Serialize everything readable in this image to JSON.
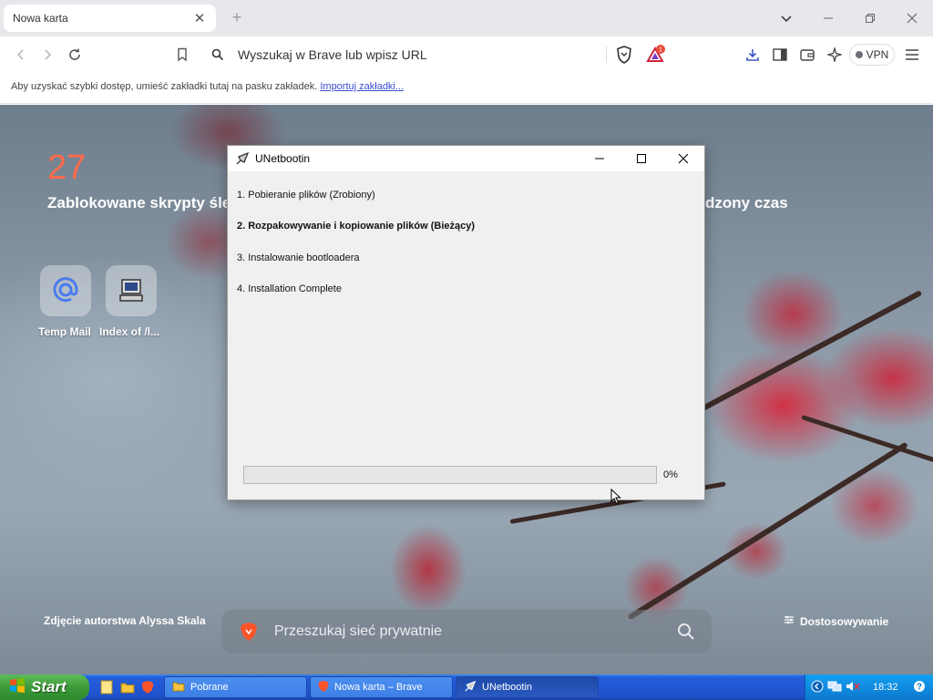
{
  "browser": {
    "tab": {
      "title": "Nowa karta"
    },
    "address_bar": {
      "placeholder": "Wyszukaj w Brave lub wpisz URL"
    },
    "shields_badge": "1",
    "vpn_label": "VPN",
    "bookmarks_bar": {
      "hint": "Aby uzyskać szybki dostęp, umieść zakładki tutaj na pasku zakładek.",
      "import_link": "Importuj zakładki..."
    }
  },
  "new_tab_page": {
    "stats": {
      "blocked_count": "27",
      "blocked_label": "Zablokowane skrypty śle",
      "saved_time_label": "dzony czas"
    },
    "tiles": [
      {
        "label": "Temp Mail",
        "icon": "at-sign-icon"
      },
      {
        "label": "Index of /l...",
        "icon": "computer-icon"
      }
    ],
    "photo_credit": "Zdjęcie autorstwa Alyssa Skala",
    "search_placeholder": "Przeszukaj sieć prywatnie",
    "customize_label": "Dostosowywanie"
  },
  "dialog": {
    "title": "UNetbootin",
    "steps": [
      {
        "text": "1. Pobieranie plików (Zrobiony)",
        "current": false
      },
      {
        "text": "2. Rozpakowywanie i kopiowanie plików (Bieżący)",
        "current": true
      },
      {
        "text": "3. Instalowanie bootloadera",
        "current": false
      },
      {
        "text": "4. Installation Complete",
        "current": false
      }
    ],
    "progress": {
      "value": 0,
      "label": "0%"
    }
  },
  "taskbar": {
    "start_label": "Start",
    "tasks": [
      {
        "label": "Pobrane",
        "icon": "folder-icon"
      },
      {
        "label": "Nowa karta – Brave",
        "icon": "brave-lion-icon"
      },
      {
        "label": "UNetbootin",
        "icon": "unetbootin-icon",
        "active": true
      }
    ],
    "clock": "18:32"
  }
}
